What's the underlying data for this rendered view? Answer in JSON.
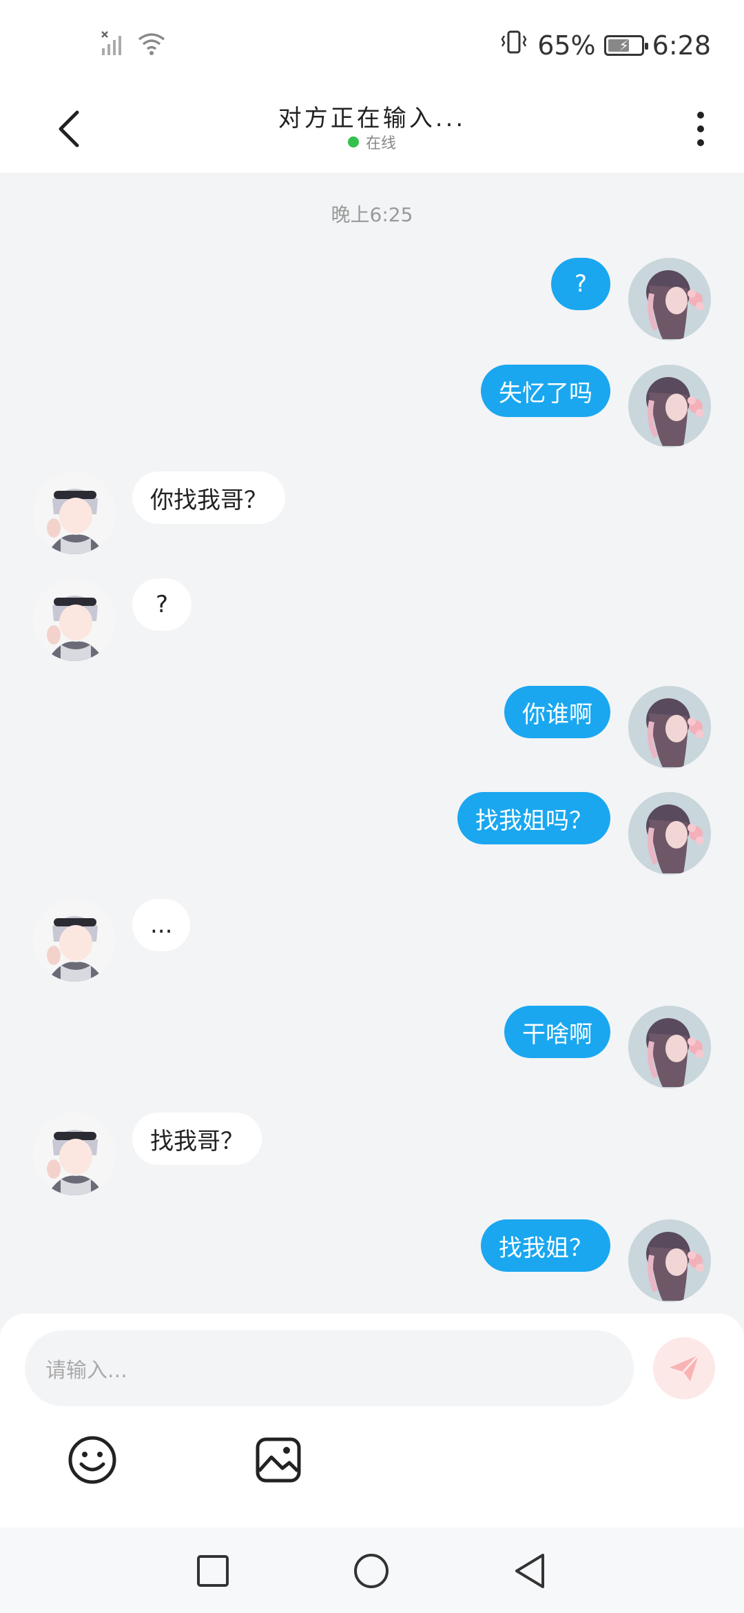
{
  "status_bar": {
    "signal_icon": "signal-off-icon",
    "wifi_icon": "wifi-icon",
    "vibrate_icon": "vibrate-icon",
    "battery_percent": "65%",
    "battery_level": 0.65,
    "time": "6:28"
  },
  "header": {
    "title": "对方正在输入...",
    "status": "在线",
    "status_color": "#33c24d",
    "back_icon": "chevron-left-icon",
    "more_icon": "more-vertical-icon"
  },
  "chat": {
    "timestamp": "晚上6:25",
    "mine_color": "#1aa7f0",
    "theirs_color": "#ffffff",
    "messages": [
      {
        "side": "mine",
        "text": "?"
      },
      {
        "side": "mine",
        "text": "失忆了吗"
      },
      {
        "side": "theirs",
        "text": "你找我哥？"
      },
      {
        "side": "theirs",
        "text": "?"
      },
      {
        "side": "mine",
        "text": "你谁啊"
      },
      {
        "side": "mine",
        "text": "找我姐吗？"
      },
      {
        "side": "theirs",
        "text": "..."
      },
      {
        "side": "mine",
        "text": "干啥啊"
      },
      {
        "side": "theirs",
        "text": "找我哥？"
      },
      {
        "side": "mine",
        "text": "找我姐？"
      }
    ]
  },
  "composer": {
    "placeholder": "请输入...",
    "send_icon": "send-icon",
    "emoji_icon": "smiley-icon",
    "image_icon": "image-icon"
  },
  "nav_bar": {
    "recents_icon": "square-icon",
    "home_icon": "circle-icon",
    "back_icon": "triangle-back-icon"
  }
}
